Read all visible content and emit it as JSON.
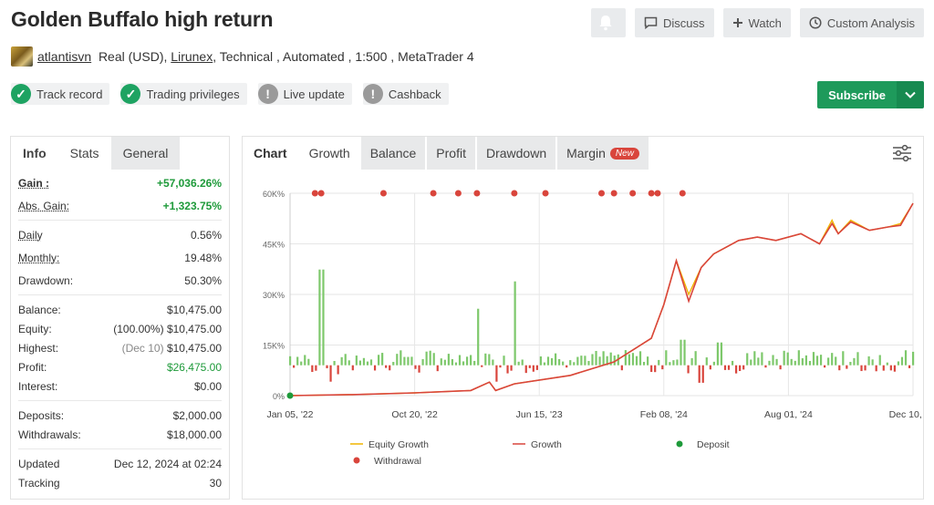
{
  "header": {
    "title": "Golden Buffalo high return",
    "user": "atlantisvn",
    "account_type": "Real (USD),",
    "broker": "Lirunex",
    "details": ", Technical , Automated , 1:500 , MetaTrader 4"
  },
  "actions": {
    "discuss": "Discuss",
    "watch": "Watch",
    "custom_analysis": "Custom Analysis",
    "subscribe": "Subscribe"
  },
  "badges": [
    {
      "label": "Track record",
      "status": "ok"
    },
    {
      "label": "Trading privileges",
      "status": "ok"
    },
    {
      "label": "Live update",
      "status": "warn"
    },
    {
      "label": "Cashback",
      "status": "warn"
    }
  ],
  "left_tabs": {
    "info": "Info",
    "stats": "Stats",
    "general": "General"
  },
  "stats": {
    "gain_label": "Gain :",
    "gain": "+57,036.26%",
    "abs_gain_label": "Abs. Gain:",
    "abs_gain": "+1,323.75%",
    "daily_label": "Daily",
    "daily": "0.56%",
    "monthly_label": "Monthly:",
    "monthly": "19.48%",
    "drawdown_label": "Drawdown:",
    "drawdown": "50.30%",
    "balance_label": "Balance:",
    "balance": "$10,475.00",
    "equity_label": "Equity:",
    "equity_pct": "(100.00%)",
    "equity": "$10,475.00",
    "highest_label": "Highest:",
    "highest_date": "(Dec 10)",
    "highest": "$10,475.00",
    "profit_label": "Profit:",
    "profit": "$26,475.00",
    "interest_label": "Interest:",
    "interest": "$0.00",
    "deposits_label": "Deposits:",
    "deposits": "$2,000.00",
    "withdrawals_label": "Withdrawals:",
    "withdrawals": "$18,000.00",
    "updated_label": "Updated",
    "updated": "Dec 12, 2024 at 02:24",
    "tracking_label": "Tracking",
    "tracking": "30"
  },
  "chart_tabs": {
    "chart": "Chart",
    "growth": "Growth",
    "balance": "Balance",
    "profit": "Profit",
    "drawdown": "Drawdown",
    "margin": "Margin",
    "new": "New"
  },
  "colors": {
    "green": "#1e9a5b",
    "growth_line": "#d9453c",
    "equity_line": "#f0b400",
    "bar_pos": "#7dc86b",
    "bar_neg": "#d9453c"
  },
  "chart_data": {
    "type": "line",
    "ylabels": [
      "60K%",
      "45K%",
      "30K%",
      "15K%",
      "0%"
    ],
    "ylim": [
      0,
      60000
    ],
    "xlabels": [
      "Jan 05, '22",
      "Oct 20, '22",
      "Jun 15, '23",
      "Feb 08, '24",
      "Aug 01, '24",
      "Dec 10, '24"
    ],
    "x_positions": [
      0,
      0.2,
      0.4,
      0.6,
      0.8,
      1.0
    ],
    "series": [
      {
        "name": "Equity Growth",
        "x": [
          0,
          0.1,
          0.2,
          0.29,
          0.32,
          0.33,
          0.36,
          0.45,
          0.52,
          0.58,
          0.6,
          0.62,
          0.64,
          0.66,
          0.68,
          0.7,
          0.72,
          0.75,
          0.78,
          0.82,
          0.85,
          0.87,
          0.88,
          0.9,
          0.93,
          0.96,
          0.98,
          1.0
        ],
        "y": [
          0,
          300,
          800,
          1500,
          4000,
          1500,
          3500,
          6000,
          10000,
          17000,
          27000,
          40000,
          30000,
          38000,
          42000,
          44000,
          46000,
          47000,
          46000,
          48000,
          45000,
          52000,
          48000,
          52000,
          49000,
          50000,
          51000,
          57000
        ]
      },
      {
        "name": "Growth",
        "x": [
          0,
          0.1,
          0.2,
          0.29,
          0.32,
          0.33,
          0.36,
          0.45,
          0.52,
          0.58,
          0.6,
          0.62,
          0.64,
          0.66,
          0.68,
          0.7,
          0.72,
          0.75,
          0.78,
          0.82,
          0.85,
          0.87,
          0.88,
          0.9,
          0.93,
          0.96,
          0.98,
          1.0
        ],
        "y": [
          0,
          300,
          800,
          1500,
          4000,
          1500,
          3500,
          6000,
          10000,
          17000,
          27000,
          40000,
          28000,
          38000,
          42000,
          44000,
          46000,
          47000,
          46000,
          48000,
          45000,
          51000,
          48000,
          51500,
          49000,
          50000,
          50500,
          57036
        ]
      }
    ],
    "withdrawal_x": [
      0.04,
      0.05,
      0.15,
      0.23,
      0.27,
      0.3,
      0.36,
      0.41,
      0.5,
      0.52,
      0.55,
      0.58,
      0.59,
      0.63
    ],
    "deposit_x": [
      0.0
    ],
    "legend": [
      "Equity Growth",
      "Growth",
      "Deposit",
      "Withdrawal"
    ]
  }
}
